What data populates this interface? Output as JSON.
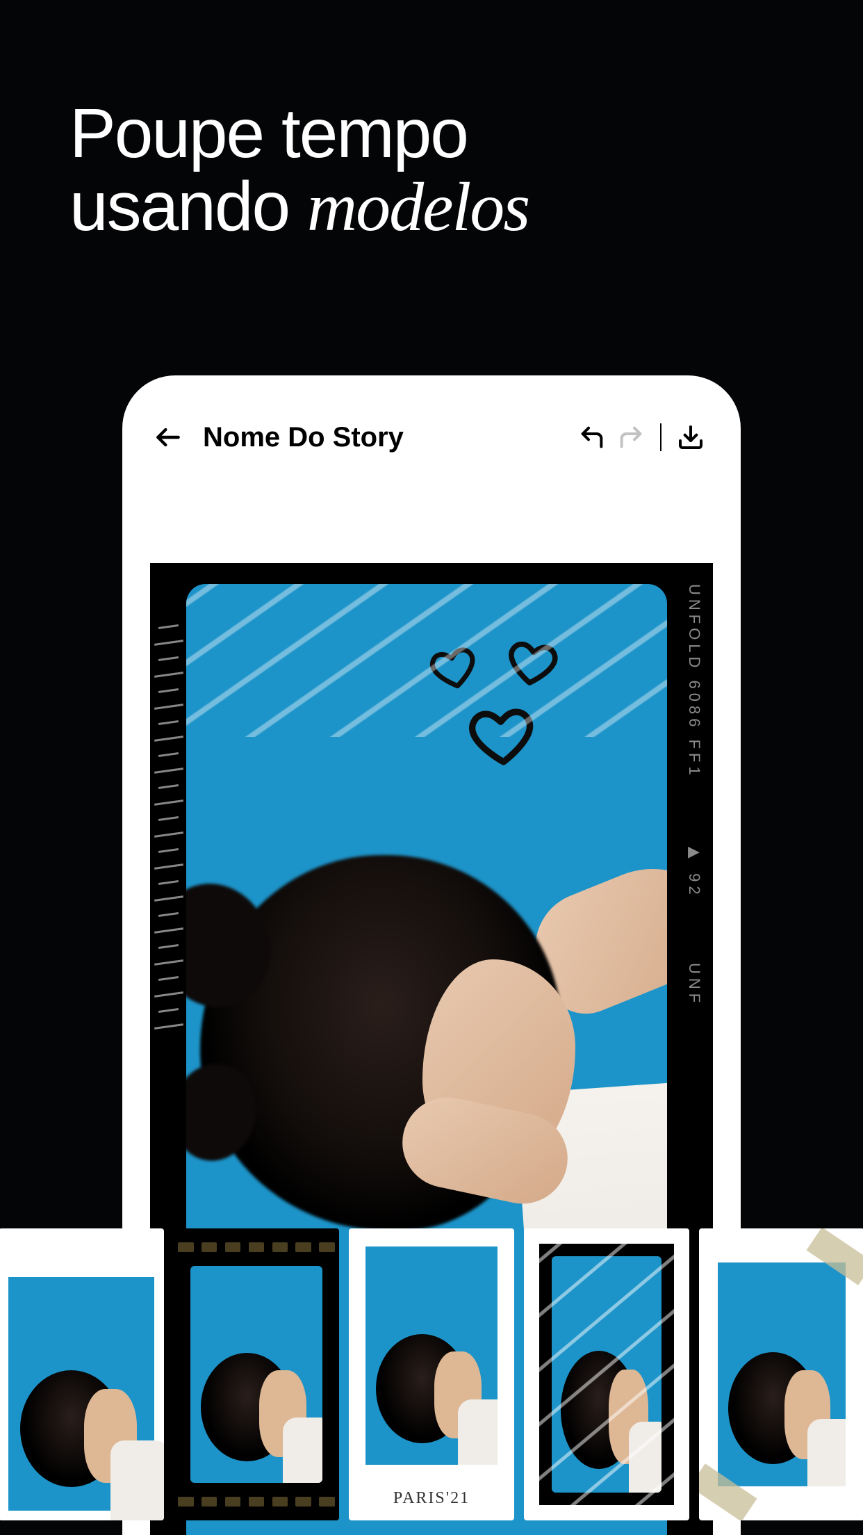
{
  "headline": {
    "line1": "Poupe tempo",
    "line2_a": "usando ",
    "line2_b_italic": "modelos"
  },
  "editor": {
    "title": "Nome Do Story",
    "canvas_film_label": "UNFOLD 6086 FF1",
    "canvas_film_marker": "▶ 92",
    "canvas_film_label_bottom": "UNF"
  },
  "templates": [
    {
      "id": "torn-edge",
      "caption": ""
    },
    {
      "id": "film-frame",
      "caption": ""
    },
    {
      "id": "polaroid",
      "caption": "PARIS'21"
    },
    {
      "id": "plastic-film",
      "caption": ""
    },
    {
      "id": "taped",
      "caption": ""
    }
  ]
}
